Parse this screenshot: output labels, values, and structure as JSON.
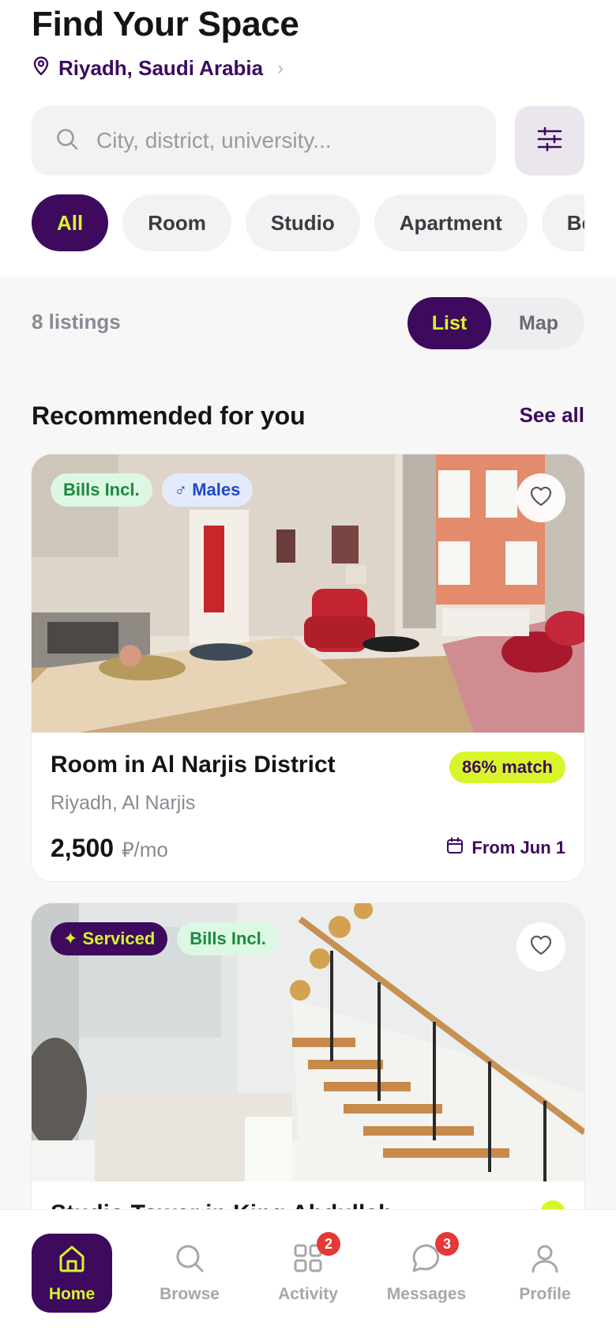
{
  "header": {
    "title": "Find Your Space",
    "location": "Riyadh, Saudi Arabia",
    "location_chevron": "›"
  },
  "search": {
    "placeholder": "City, district, university..."
  },
  "categories": [
    {
      "label": "All",
      "active": true
    },
    {
      "label": "Room",
      "active": false
    },
    {
      "label": "Studio",
      "active": false
    },
    {
      "label": "Apartment",
      "active": false
    },
    {
      "label": "Be",
      "active": false
    }
  ],
  "results": {
    "count": "8 listings",
    "view_list": "List",
    "view_map": "Map",
    "selected_view": "List"
  },
  "section": {
    "title": "Recommended for you",
    "see_all": "See all"
  },
  "listings": [
    {
      "tags": [
        "Bills Incl.",
        "♂ Males"
      ],
      "title": "Room in Al Narjis District",
      "match": "86% match",
      "location": "Riyadh, Al Narjis",
      "price": "2,500",
      "price_unit": "⃁/mo",
      "availability": "From Jun 1"
    },
    {
      "tags": [
        "✦ Serviced",
        "Bills Incl."
      ],
      "title": "Studio Tower in King Abdullah",
      "match": ""
    }
  ],
  "bottom_nav": {
    "home": "Home",
    "browse": "Browse",
    "activity": "Activity",
    "activity_badge": "2",
    "messages": "Messages",
    "messages_badge": "3",
    "profile": "Profile"
  },
  "colors": {
    "brand": "#3d0a5e",
    "accent": "#d7f52a",
    "badge": "#e53935"
  }
}
